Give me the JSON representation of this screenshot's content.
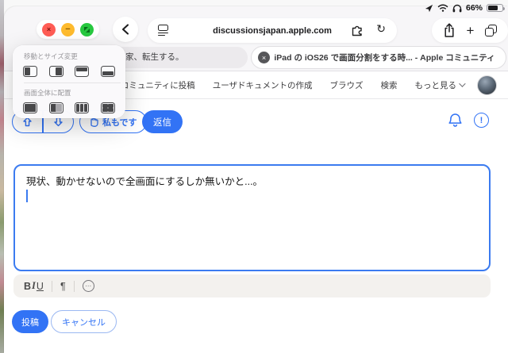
{
  "status_bar": {
    "battery_level": "66%"
  },
  "browser_chrome": {
    "url": "discussionsjapan.apple.com"
  },
  "window_controls_menu": {
    "move_resize_label": "移動とサイズ変更",
    "arrange_label": "画面全体に配置",
    "move_icons": [
      "left-half",
      "right-half",
      "top-half",
      "bottom-half"
    ],
    "arrange_icons": [
      "full-screen",
      "split-two",
      "three-columns",
      "grid-four"
    ]
  },
  "tabs": {
    "background_tab_title": "家、転生する。",
    "active_tab_title": "iPad の iOS26 で画面分割をする時... - Apple コミュニティ"
  },
  "site_header": {
    "links": [
      "コミュニティに投稿",
      "ユーザドキュメントの作成",
      "ブラウズ",
      "検索"
    ],
    "more_label": "もっと見る"
  },
  "thread_actions": {
    "me_too_label": "私もです",
    "reply_label": "返信"
  },
  "editor": {
    "text": "現状、動かせないので全画面にするしか無いかと...。",
    "toolbar": {
      "bold": "B",
      "italic": "I",
      "underline": "U",
      "pilcrow": "¶",
      "ellipsis": "⋯"
    }
  },
  "form_actions": {
    "post_label": "投稿",
    "cancel_label": "キャンセル"
  },
  "glyphs": {
    "close": "×",
    "minus": "−",
    "plus": "+",
    "reload": "↻",
    "tab_close": "×",
    "exclamation": "!"
  },
  "colors": {
    "accent_blue": "#3273f5",
    "editor_border": "#3b7bf0"
  }
}
